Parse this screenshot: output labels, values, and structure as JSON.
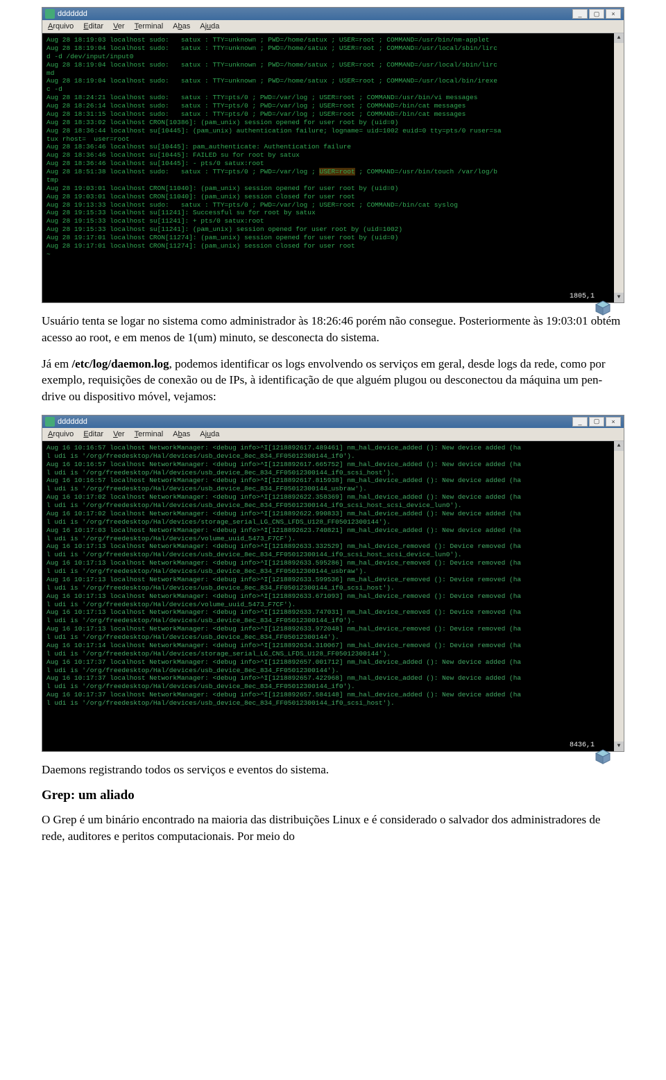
{
  "window_title": "ddddddd",
  "menu": {
    "arquivo": "Arquivo",
    "editar": "Editar",
    "ver": "Ver",
    "terminal": "Terminal",
    "abas": "Abas",
    "ajuda": "Ajuda"
  },
  "term1": {
    "lines": [
      "Aug 28 18:19:03 localhost sudo:   satux : TTY=unknown ; PWD=/home/satux ; USER=root ; COMMAND=/usr/bin/nm-applet",
      "Aug 28 18:19:04 localhost sudo:   satux : TTY=unknown ; PWD=/home/satux ; USER=root ; COMMAND=/usr/local/sbin/lirc",
      "d -d /dev/input/input0",
      "Aug 28 18:19:04 localhost sudo:   satux : TTY=unknown ; PWD=/home/satux ; USER=root ; COMMAND=/usr/local/sbin/lirc",
      "md",
      "Aug 28 18:19:04 localhost sudo:   satux : TTY=unknown ; PWD=/home/satux ; USER=root ; COMMAND=/usr/local/bin/irexe",
      "c -d",
      "Aug 28 18:24:21 localhost sudo:   satux : TTY=pts/0 ; PWD=/var/log ; USER=root ; COMMAND=/usr/bin/vi messages",
      "Aug 28 18:26:14 localhost sudo:   satux : TTY=pts/0 ; PWD=/var/log ; USER=root ; COMMAND=/bin/cat messages",
      "Aug 28 18:31:15 localhost sudo:   satux : TTY=pts/0 ; PWD=/var/log ; USER=root ; COMMAND=/bin/cat messages",
      "Aug 28 18:33:02 localhost CRON[10386]: (pam_unix) session opened for user root by (uid=0)",
      "Aug 28 18:36:44 localhost su[10445]: (pam_unix) authentication failure; logname= uid=1002 euid=0 tty=pts/0 ruser=sa",
      "tux rhost=  user=root",
      "",
      "Aug 28 18:36:46 localhost su[10445]: pam_authenticate: Authentication failure",
      "Aug 28 18:36:46 localhost su[10445]: FAILED su for root by satux",
      "Aug 28 18:36:46 localhost su[10445]: - pts/0 satux:root",
      "Aug 28 18:51:38 localhost sudo:   satux : TTY=pts/0 ; PWD=/var/log ; USER=root ; COMMAND=/usr/bin/touch /var/log/b",
      "tmp",
      "Aug 28 19:03:01 localhost CRON[11040]: (pam_unix) session opened for user root by (uid=0)",
      "Aug 28 19:03:01 localhost CRON[11040]: (pam_unix) session closed for user root",
      "Aug 28 19:13:33 localhost sudo:   satux : TTY=pts/0 ; PWD=/var/log ; USER=root ; COMMAND=/bin/cat syslog",
      "Aug 28 19:15:33 localhost su[11241]: Successful su for root by satux",
      "Aug 28 19:15:33 localhost su[11241]: + pts/0 satux:root",
      "Aug 28 19:15:33 localhost su[11241]: (pam_unix) session opened for user root by (uid=1002)",
      "Aug 28 19:17:01 localhost CRON[11274]: (pam_unix) session opened for user root by (uid=0)",
      "Aug 28 19:17:01 localhost CRON[11274]: (pam_unix) session closed for user root",
      "~"
    ],
    "status": "1805,1",
    "highlight_text": "USER=root"
  },
  "para1_a": "Usuário tenta se logar no sistema como administrador às 18:26:46 porém não consegue. Posteriormente às 19:03:01 obtém acesso ao root, e em menos de 1(um) minuto, se desconecta do sistema.",
  "para2_a": "Já em ",
  "para2_path": "/etc/log/daemon.log",
  "para2_b": ", podemos identificar os logs envolvendo os serviços em geral, desde logs da rede, como por exemplo, requisições de conexão ou de IPs, à identificação de que alguém plugou ou desconectou da máquina um pen-drive ou dispositivo móvel, vejamos:",
  "term2": {
    "lines": [
      "Aug 16 10:16:57 localhost NetworkManager: <debug info>^I[1218892617.489461] nm_hal_device_added (): New device added (ha",
      "l udi is '/org/freedesktop/Hal/devices/usb_device_8ec_834_FF05012300144_if0').",
      "Aug 16 10:16:57 localhost NetworkManager: <debug info>^I[1218892617.665752] nm_hal_device_added (): New device added (ha",
      "l udi is '/org/freedesktop/Hal/devices/usb_device_8ec_834_FF05012300144_if0_scsi_host').",
      "Aug 16 10:16:57 localhost NetworkManager: <debug info>^I[1218892617.815938] nm_hal_device_added (): New device added (ha",
      "l udi is '/org/freedesktop/Hal/devices/usb_device_8ec_834_FF05012300144_usbraw').",
      "Aug 16 10:17:02 localhost NetworkManager: <debug info>^I[1218892622.358369] nm_hal_device_added (): New device added (ha",
      "l udi is '/org/freedesktop/Hal/devices/usb_device_8ec_834_FF05012300144_if0_scsi_host_scsi_device_lun0').",
      "Aug 16 10:17:02 localhost NetworkManager: <debug info>^I[1218892622.990833] nm_hal_device_added (): New device added (ha",
      "l udi is '/org/freedesktop/Hal/devices/storage_serial_LG_CNS_LFDS_U128_FF05012300144').",
      "Aug 16 10:17:03 localhost NetworkManager: <debug info>^I[1218892623.740821] nm_hal_device_added (): New device added (ha",
      "l udi is '/org/freedesktop/Hal/devices/volume_uuid_5473_F7CF').",
      "Aug 16 10:17:13 localhost NetworkManager: <debug info>^I[1218892633.332529] nm_hal_device_removed (): Device removed (ha",
      "l udi is '/org/freedesktop/Hal/devices/usb_device_8ec_834_FF05012300144_if0_scsi_host_scsi_device_lun0').",
      "Aug 16 10:17:13 localhost NetworkManager: <debug info>^I[1218892633.595286] nm_hal_device_removed (): Device removed (ha",
      "l udi is '/org/freedesktop/Hal/devices/usb_device_8ec_834_FF05012300144_usbraw').",
      "Aug 16 10:17:13 localhost NetworkManager: <debug info>^I[1218892633.599536] nm_hal_device_removed (): Device removed (ha",
      "l udi is '/org/freedesktop/Hal/devices/usb_device_8ec_834_FF05012300144_if0_scsi_host').",
      "Aug 16 10:17:13 localhost NetworkManager: <debug info>^I[1218892633.671093] nm_hal_device_removed (): Device removed (ha",
      "l udi is '/org/freedesktop/Hal/devices/volume_uuid_5473_F7CF').",
      "Aug 16 10:17:13 localhost NetworkManager: <debug info>^I[1218892633.747031] nm_hal_device_removed (): Device removed (ha",
      "l udi is '/org/freedesktop/Hal/devices/usb_device_8ec_834_FF05012300144_if0').",
      "Aug 16 10:17:13 localhost NetworkManager: <debug info>^I[1218892633.972048] nm_hal_device_removed (): Device removed (ha",
      "l udi is '/org/freedesktop/Hal/devices/usb_device_8ec_834_FF05012300144').",
      "Aug 16 10:17:14 localhost NetworkManager: <debug info>^I[1218892634.310067] nm_hal_device_removed (): Device removed (ha",
      "l udi is '/org/freedesktop/Hal/devices/storage_serial_LG_CNS_LFDS_U128_FF05012300144').",
      "Aug 16 10:17:37 localhost NetworkManager: <debug info>^I[1218892657.001712] nm_hal_device_added (): New device added (ha",
      "l udi is '/org/freedesktop/Hal/devices/usb_device_8ec_834_FF05012300144').",
      "Aug 16 10:17:37 localhost NetworkManager: <debug info>^I[1218892657.422968] nm_hal_device_added (): New device added (ha",
      "l udi is '/org/freedesktop/Hal/devices/usb_device_8ec_834_FF05012300144_if0').",
      "Aug 16 10:17:37 localhost NetworkManager: <debug info>^I[1218892657.584148] nm_hal_device_added (): New device added (ha",
      "l udi is '/org/freedesktop/Hal/devices/usb_device_8ec_834_FF05012300144_if0_scsi_host')."
    ],
    "status": "8436,1"
  },
  "para3": "Daemons registrando todos os serviços e eventos do sistema.",
  "h2": "Grep: um aliado",
  "para4": "O Grep é um binário encontrado na maioria das distribuições Linux e é considerado o salvador dos administradores de rede, auditores e peritos computacionais. Por meio do"
}
